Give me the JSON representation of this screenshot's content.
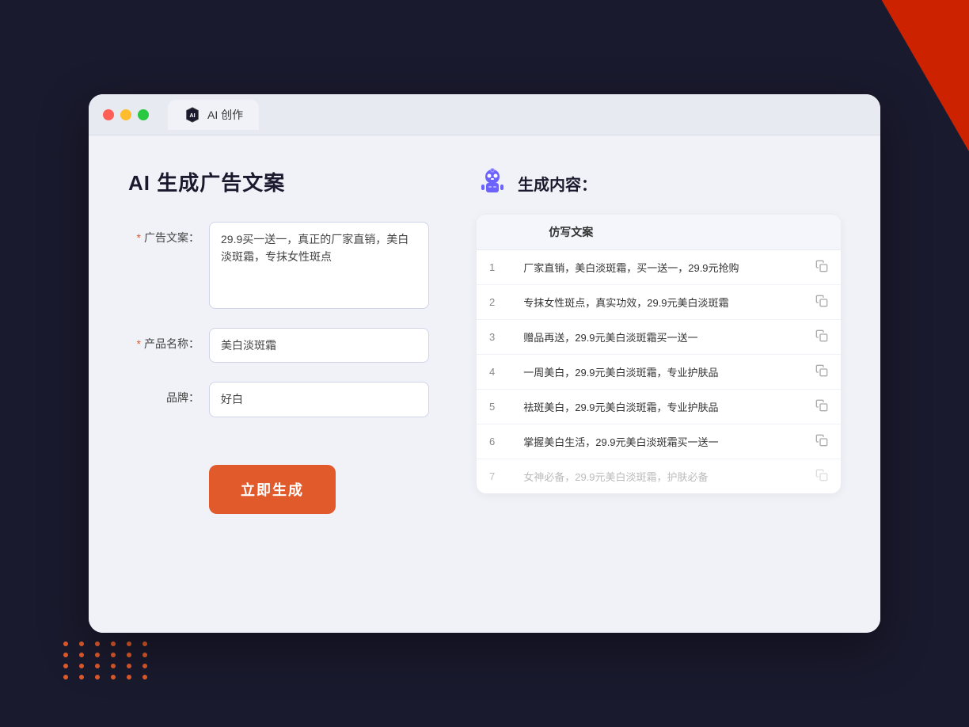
{
  "browser": {
    "tab_label": "AI 创作",
    "traffic_lights": [
      "red",
      "yellow",
      "green"
    ]
  },
  "left_panel": {
    "page_title": "AI 生成广告文案",
    "form": {
      "ad_copy_label": "广告文案：",
      "ad_copy_required": "*",
      "ad_copy_value": "29.9买一送一，真正的厂家直销，美白淡斑霜，专抹女性斑点",
      "product_name_label": "产品名称：",
      "product_name_required": "*",
      "product_name_value": "美白淡斑霜",
      "brand_label": "品牌：",
      "brand_value": "好白",
      "generate_btn_label": "立即生成"
    }
  },
  "right_panel": {
    "header_title": "生成内容：",
    "table": {
      "column_header": "仿写文案",
      "rows": [
        {
          "num": "1",
          "text": "厂家直销，美白淡斑霜，买一送一，29.9元抢购",
          "muted": false
        },
        {
          "num": "2",
          "text": "专抹女性斑点，真实功效，29.9元美白淡斑霜",
          "muted": false
        },
        {
          "num": "3",
          "text": "赠品再送，29.9元美白淡斑霜买一送一",
          "muted": false
        },
        {
          "num": "4",
          "text": "一周美白，29.9元美白淡斑霜，专业护肤品",
          "muted": false
        },
        {
          "num": "5",
          "text": "祛斑美白，29.9元美白淡斑霜，专业护肤品",
          "muted": false
        },
        {
          "num": "6",
          "text": "掌握美白生活，29.9元美白淡斑霜买一送一",
          "muted": false
        },
        {
          "num": "7",
          "text": "女神必备，29.9元美白淡斑霜，护肤必备",
          "muted": true
        }
      ]
    }
  }
}
